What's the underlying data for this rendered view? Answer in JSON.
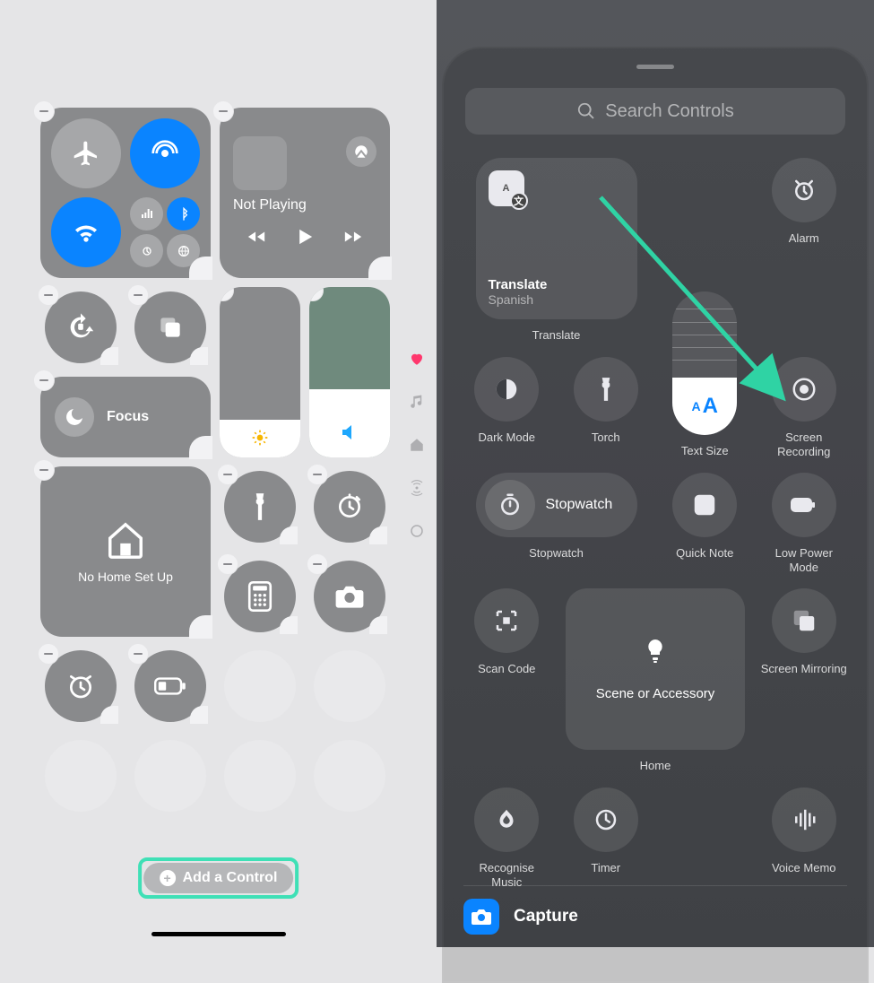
{
  "left": {
    "media": {
      "status": "Not Playing"
    },
    "focus_label": "Focus",
    "home_label": "No Home Set Up",
    "add_control_label": "Add a Control"
  },
  "right": {
    "search_placeholder": "Search Controls",
    "translate": {
      "title": "Translate",
      "sub": "Spanish",
      "label": "Translate"
    },
    "alarm": "Alarm",
    "timer": "Timer",
    "voice_memo": "Voice Memo",
    "dark_mode": "Dark Mode",
    "torch": "Torch",
    "text_size": "Text Size",
    "screen_recording": "Screen Recording",
    "stopwatch_pill": "Stopwatch",
    "stopwatch_label": "Stopwatch",
    "quick_note": "Quick Note",
    "low_power_mode": "Low Power Mode",
    "scan_code": "Scan Code",
    "home_widget": "Scene or Accessory",
    "home_label": "Home",
    "screen_mirroring": "Screen Mirroring",
    "recognise_music": "Recognise Music",
    "capture": "Capture"
  }
}
